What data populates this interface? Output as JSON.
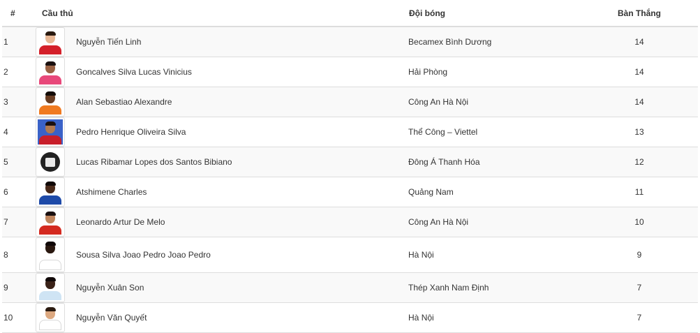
{
  "table": {
    "headers": {
      "rank": "#",
      "player": "Cầu thủ",
      "team": "Đội bóng",
      "goals": "Bàn Thắng"
    },
    "rows": [
      {
        "rank": "1",
        "name": "Nguyễn Tiến Linh",
        "team": "Becamex Bình Dương",
        "goals": "14"
      },
      {
        "rank": "2",
        "name": "Goncalves Silva Lucas Vinicius",
        "team": "Hải Phòng",
        "goals": "14"
      },
      {
        "rank": "3",
        "name": "Alan Sebastiao Alexandre",
        "team": "Công An Hà Nội",
        "goals": "14"
      },
      {
        "rank": "4",
        "name": "Pedro Henrique Oliveira Silva",
        "team": "Thể Công – Viettel",
        "goals": "13"
      },
      {
        "rank": "5",
        "name": "Lucas Ribamar Lopes dos Santos Bibiano",
        "team": "Đông Á Thanh Hóa",
        "goals": "12"
      },
      {
        "rank": "6",
        "name": "Atshimene Charles",
        "team": "Quảng Nam",
        "goals": "11"
      },
      {
        "rank": "7",
        "name": "Leonardo Artur De Melo",
        "team": "Công An Hà Nội",
        "goals": "10"
      },
      {
        "rank": "8",
        "name": "Sousa Silva Joao Pedro Joao Pedro",
        "team": "Hà Nội",
        "goals": "9"
      },
      {
        "rank": "9",
        "name": "Nguyễn Xuân Son",
        "team": "Thép Xanh Nam Định",
        "goals": "7"
      },
      {
        "rank": "10",
        "name": "Nguyễn Văn Quyết",
        "team": "Hà Nội",
        "goals": "7"
      }
    ]
  },
  "avatars": [
    {
      "icon": "player-photo-icon",
      "bg": "#ffffff",
      "skin": "#e8b896",
      "hair": "#2a1a10",
      "shirt": "#d4202a"
    },
    {
      "icon": "player-photo-icon",
      "bg": "#ffffff",
      "skin": "#9a6244",
      "hair": "#1a1010",
      "shirt": "#e8487a"
    },
    {
      "icon": "player-photo-icon",
      "bg": "#ffffff",
      "skin": "#6a3e24",
      "hair": "#140c08",
      "shirt": "#f07a20"
    },
    {
      "icon": "player-photo-icon",
      "bg": "#3a62c8",
      "skin": "#b07a52",
      "hair": "#1a1010",
      "shirt": "#c81e2a"
    },
    {
      "icon": "shirt-placeholder-icon",
      "bg": "#ffffff",
      "skin": "",
      "hair": "",
      "shirt": "#222222"
    },
    {
      "icon": "player-photo-icon",
      "bg": "#ffffff",
      "skin": "#4a2a1a",
      "hair": "#100808",
      "shirt": "#1e4aa8"
    },
    {
      "icon": "player-photo-icon",
      "bg": "#ffffff",
      "skin": "#c0865e",
      "hair": "#1a1010",
      "shirt": "#d42a20"
    },
    {
      "icon": "player-photo-icon",
      "bg": "#ffffff",
      "skin": "#2a1810",
      "hair": "#100808",
      "shirt": "#ffffff"
    },
    {
      "icon": "player-photo-icon",
      "bg": "#ffffff",
      "skin": "#3a2218",
      "hair": "#100808",
      "shirt": "#cfe4f4"
    },
    {
      "icon": "player-photo-icon",
      "bg": "#ffffff",
      "skin": "#dca880",
      "hair": "#2a1a10",
      "shirt": "#ffffff"
    }
  ]
}
